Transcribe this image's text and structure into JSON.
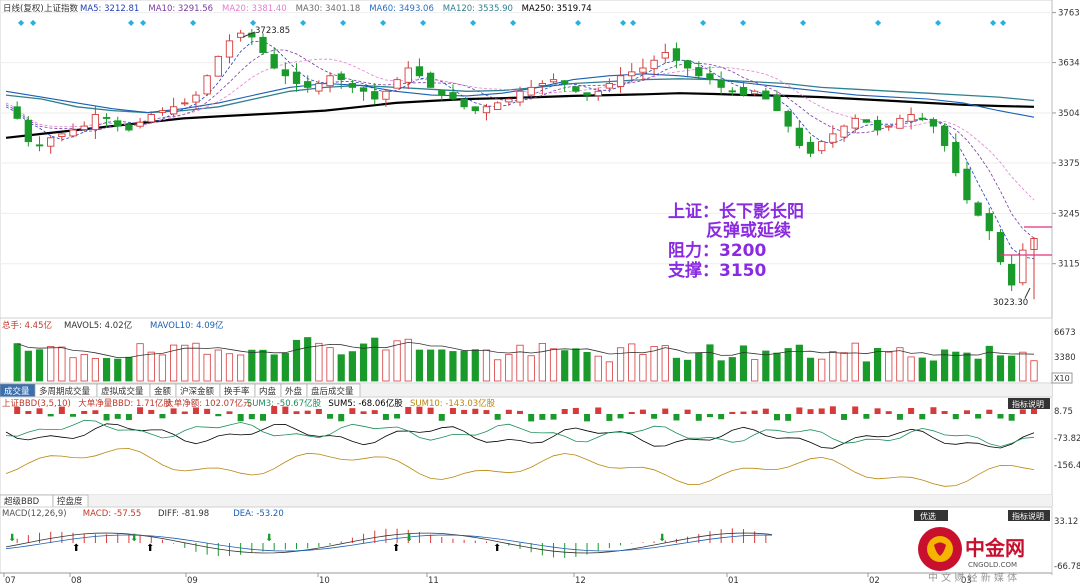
{
  "main_panel": {
    "period_label": "日线(复权)",
    "index_name": "上证指数",
    "ma": [
      {
        "label": "MA5: 3212.81",
        "color": "#1f3fb8"
      },
      {
        "label": "MA10: 3291.56",
        "color": "#7a3aa0"
      },
      {
        "label": "MA20: 3381.40",
        "color": "#e27fd0"
      },
      {
        "label": "MA30: 3401.18",
        "color": "#6b6b6b"
      },
      {
        "label": "MA60: 3493.06",
        "color": "#2a6fbf"
      },
      {
        "label": "MA120: 3535.90",
        "color": "#2f7f8f"
      },
      {
        "label": "MA250: 3519.74",
        "color": "#000000"
      }
    ],
    "high_label": "3723.85",
    "low_label": "3023.30",
    "annotation": [
      "上证：长下影长阳",
      "反弹或延续",
      "阻力：3200",
      "支撑：3150"
    ],
    "annotation_color": "#8a2be2"
  },
  "volume_panel": {
    "labels": [
      {
        "text": "总手: 4.45亿",
        "color": "#c0392b"
      },
      {
        "text": "MAVOL5: 4.02亿",
        "color": "#333333"
      },
      {
        "text": "MAVOL10: 4.09亿",
        "color": "#1a5fb4"
      }
    ],
    "scale_note": "X10"
  },
  "tabs": [
    "成交量",
    "多周期成交量",
    "虚拟成交量",
    "金额",
    "沪深金额",
    "换手率",
    "内盘",
    "外盘",
    "盘后成交量"
  ],
  "bbd_panel": {
    "labels": [
      {
        "text": "上证BBD(3,5,10)",
        "color": "#c0392b"
      },
      {
        "text": "大单净量BBD: 1.71亿股",
        "color": "#c0392b"
      },
      {
        "text": "大单净额: 102.07亿元",
        "color": "#c0392b"
      },
      {
        "text": "SUM3: -50.67亿股",
        "color": "#1a8f5a"
      },
      {
        "text": "SUM5: -68.06亿股",
        "color": "#000000"
      },
      {
        "text": "SUM10: -143.03亿股",
        "color": "#b8860b"
      }
    ],
    "button": "指标说明"
  },
  "tabs2": [
    "超级BBD",
    "控盘度"
  ],
  "macd_panel": {
    "labels": [
      {
        "text": "MACD(12,26,9)",
        "color": "#555555"
      },
      {
        "text": "MACD: -57.55",
        "color": "#c0392b"
      },
      {
        "text": "DIFF: -81.98",
        "color": "#333333"
      },
      {
        "text": "DEA: -53.20",
        "color": "#1a5fb4"
      }
    ],
    "buttons": [
      "优选",
      "指标说明"
    ]
  },
  "watermark": {
    "name": "中金网",
    "url": "CNGOLD.COM",
    "slogan": "中 文 财 经 新 媒 体"
  },
  "chart_data": [
    {
      "type": "candlestick",
      "title": "上证指数 日线(复权)",
      "x_ticks": [
        "07",
        "08",
        "09",
        "10",
        "11",
        "12",
        "01",
        "02",
        "03"
      ],
      "y_ticks": [
        3763,
        3634,
        3504,
        3375,
        3245,
        3115
      ],
      "ylim": [
        2980,
        3780
      ],
      "path": [
        3520,
        3490,
        3430,
        3420,
        3440,
        3450,
        3460,
        3470,
        3500,
        3490,
        3470,
        3460,
        3480,
        3500,
        3510,
        3520,
        3530,
        3550,
        3600,
        3650,
        3690,
        3710,
        3700,
        3660,
        3620,
        3600,
        3580,
        3570,
        3580,
        3600,
        3590,
        3570,
        3560,
        3540,
        3560,
        3590,
        3620,
        3600,
        3570,
        3550,
        3540,
        3520,
        3510,
        3520,
        3530,
        3540,
        3560,
        3570,
        3580,
        3590,
        3580,
        3560,
        3550,
        3560,
        3580,
        3600,
        3610,
        3620,
        3640,
        3660,
        3640,
        3620,
        3600,
        3590,
        3570,
        3560,
        3550,
        3560,
        3540,
        3510,
        3470,
        3420,
        3400,
        3430,
        3450,
        3470,
        3490,
        3480,
        3460,
        3470,
        3490,
        3500,
        3490,
        3470,
        3420,
        3350,
        3280,
        3240,
        3200,
        3120,
        3060,
        3150,
        3180
      ],
      "high": 3723.85,
      "low": 3023.3,
      "ma_lines": [
        {
          "name": "MA250",
          "values": [
            3440,
            3450,
            3460,
            3470,
            3480,
            3490,
            3495,
            3500,
            3505,
            3510,
            3520,
            3530,
            3535,
            3540,
            3542,
            3545,
            3548,
            3550,
            3552,
            3555,
            3553,
            3550,
            3548,
            3545,
            3540,
            3535,
            3530,
            3525,
            3522,
            3520
          ]
        },
        {
          "name": "MA120",
          "values": [
            3550,
            3540,
            3520,
            3510,
            3505,
            3510,
            3520,
            3540,
            3560,
            3570,
            3575,
            3570,
            3565,
            3560,
            3562,
            3570,
            3580,
            3585,
            3590,
            3592,
            3590,
            3585,
            3580,
            3570,
            3565,
            3560,
            3555,
            3550,
            3545,
            3536
          ]
        },
        {
          "name": "MA60",
          "values": [
            3560,
            3545,
            3530,
            3515,
            3505,
            3515,
            3530,
            3550,
            3570,
            3580,
            3575,
            3560,
            3550,
            3548,
            3555,
            3570,
            3590,
            3600,
            3605,
            3600,
            3590,
            3580,
            3570,
            3560,
            3550,
            3545,
            3540,
            3530,
            3510,
            3493
          ]
        }
      ]
    },
    {
      "type": "bar",
      "title": "成交量",
      "y_ticks": [
        6673,
        3380
      ],
      "ylim": [
        0,
        7000
      ]
    },
    {
      "type": "line",
      "title": "上证BBD(3,5,10)",
      "y_ticks": [
        8.75,
        -73.82,
        -156.4
      ]
    },
    {
      "type": "bar",
      "title": "MACD(12,26,9)",
      "y_ticks": [
        33.12,
        -66.78
      ]
    }
  ]
}
